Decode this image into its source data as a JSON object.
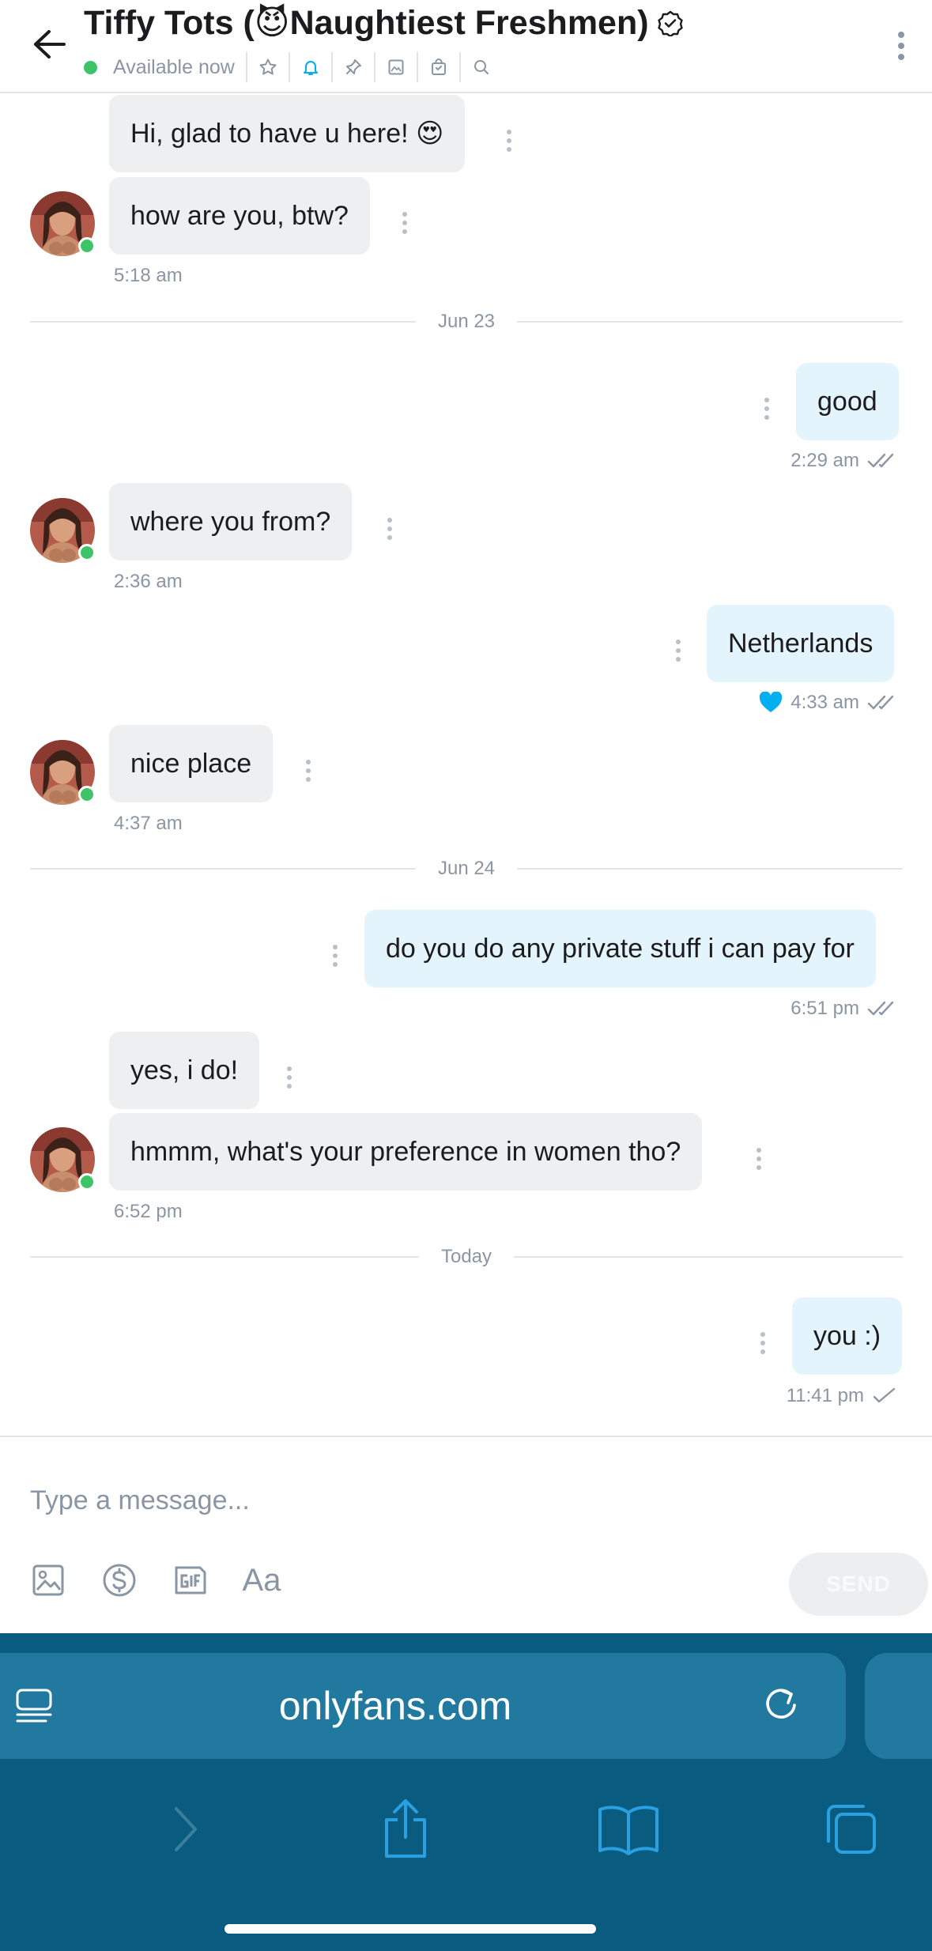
{
  "header": {
    "title": "Tiffy Tots (😈Naughtiest Freshmen)",
    "status": "Available now"
  },
  "messages": [
    {
      "dir": "in",
      "text": "Hi, glad to have u here! 😍"
    },
    {
      "dir": "in",
      "text": "how are you, btw?",
      "time": "5:18 am"
    },
    {
      "separator": "Jun 23"
    },
    {
      "dir": "out",
      "text": "good",
      "time": "2:29 am",
      "read": true
    },
    {
      "dir": "in",
      "text": "where you from?",
      "time": "2:36 am"
    },
    {
      "dir": "out",
      "text": "Netherlands",
      "time": "4:33 am",
      "read": true,
      "liked": true
    },
    {
      "dir": "in",
      "text": "nice place",
      "time": "4:37 am"
    },
    {
      "separator": "Jun 24"
    },
    {
      "dir": "out",
      "text": "do you do any private stuff i can pay for",
      "time": "6:51 pm",
      "read": true
    },
    {
      "dir": "in",
      "text": "yes, i do!"
    },
    {
      "dir": "in",
      "text": "hmmm, what's your preference in women tho?",
      "time": "6:52 pm"
    },
    {
      "separator": "Today"
    },
    {
      "dir": "out",
      "text": "you :)",
      "time": "11:41 pm",
      "read": false
    }
  ],
  "composer": {
    "placeholder": "Type a message...",
    "text_tool": "Aa",
    "send_label": "SEND"
  },
  "browser": {
    "url": "onlyfans.com"
  },
  "colors": {
    "online": "#3ec468",
    "accent": "#00aff0",
    "out_bubble": "#e3f4fc",
    "in_bubble": "#eeeff1",
    "browser_bg": "#095b80"
  }
}
